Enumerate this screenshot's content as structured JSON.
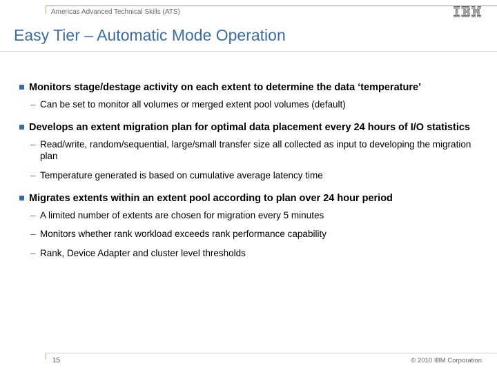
{
  "header": {
    "org": "Americas Advanced Technical Skills (ATS)",
    "logo_name": "ibm-logo"
  },
  "title": "Easy Tier – Automatic Mode Operation",
  "bullets": [
    {
      "text": "Monitors stage/destage activity on each extent to determine the data ‘temperature’",
      "subs": [
        "Can be set to monitor all volumes or merged extent pool volumes (default)"
      ]
    },
    {
      "text": "Develops an extent migration plan for optimal data placement every 24 hours of I/O statistics",
      "subs": [
        "Read/write, random/sequential, large/small transfer size all collected as input to developing the migration plan",
        "Temperature generated is based on cumulative average latency time"
      ]
    },
    {
      "text": "Migrates extents within an extent pool according to plan over 24 hour period",
      "subs": [
        "A limited number of extents are chosen for migration every 5 minutes",
        "Monitors whether rank workload exceeds rank performance capability",
        "Rank, Device Adapter and cluster level thresholds"
      ]
    }
  ],
  "footer": {
    "page": "15",
    "copyright": "© 2010 IBM Corporation"
  }
}
